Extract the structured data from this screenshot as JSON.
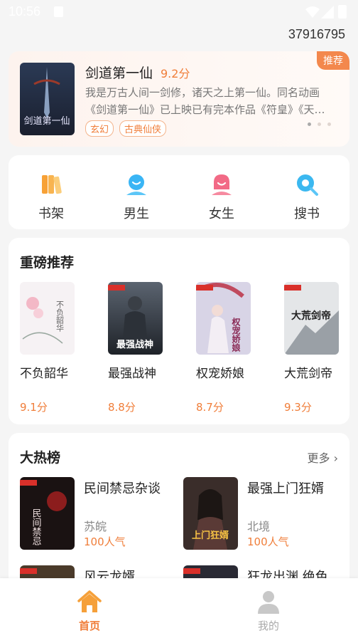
{
  "status_bar": {
    "time": "10:56"
  },
  "user_id": "37916795",
  "banner": {
    "tag": "推荐",
    "title": "剑道第一仙",
    "score": "9.2分",
    "desc_line1": "我是万古人间一剑修，诸天之上第一仙。同名动画",
    "desc_line2": "《剑道第一仙》已上映已有完本作品《符皇》《天…",
    "tags": [
      "玄幻",
      "古典仙侠"
    ],
    "cover_text": "剑道第一仙"
  },
  "nav": [
    {
      "label": "书架",
      "icon": "bookshelf-icon"
    },
    {
      "label": "男生",
      "icon": "male-icon"
    },
    {
      "label": "女生",
      "icon": "female-icon"
    },
    {
      "label": "搜书",
      "icon": "search-book-icon"
    }
  ],
  "recommend": {
    "title": "重磅推荐",
    "books": [
      {
        "name": "不负韶华",
        "score": "9.1分",
        "cover_text": "不负韶华"
      },
      {
        "name": "最强战神",
        "score": "8.8分",
        "cover_text": "最强战神"
      },
      {
        "name": "权宠娇娘",
        "score": "8.7分",
        "cover_text": "权宠娇娘"
      },
      {
        "name": "大荒剑帝",
        "score": "9.3分",
        "cover_text": "大荒剑帝"
      }
    ]
  },
  "hot": {
    "title": "大热榜",
    "more": "更多",
    "books": [
      {
        "name": "民间禁忌杂谈",
        "author": "苏皖",
        "pop": "100人气",
        "cover_text": "民间禁忌"
      },
      {
        "name": "最强上门狂婿",
        "author": "北境",
        "pop": "100人气",
        "cover_text": "上门狂婿"
      },
      {
        "name": "风云龙婿",
        "author": "",
        "pop": "",
        "cover_text": ""
      },
      {
        "name": "狂龙出渊 绝色",
        "author": "",
        "pop": "",
        "cover_text": ""
      }
    ]
  },
  "tabbar": [
    {
      "label": "首页",
      "icon": "home-icon",
      "active": true
    },
    {
      "label": "我的",
      "icon": "profile-icon",
      "active": false
    }
  ],
  "colors": {
    "accent": "#f07e3a",
    "background": "#f5f5f5"
  }
}
